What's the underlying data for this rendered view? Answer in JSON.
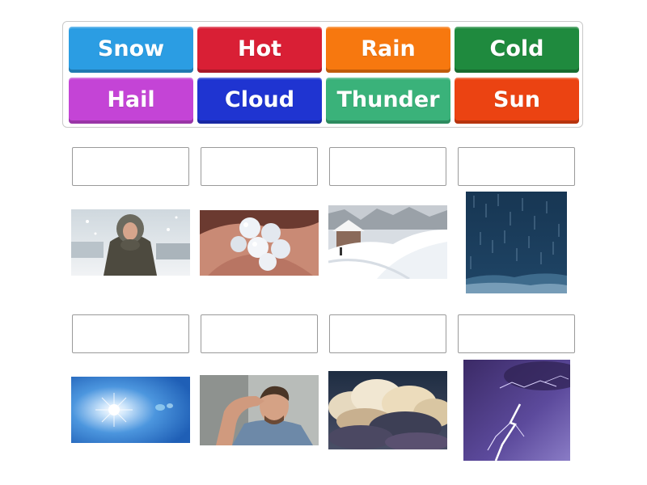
{
  "tiles": [
    {
      "label": "Snow",
      "color": "#2b9de3"
    },
    {
      "label": "Hot",
      "color": "#d91f35"
    },
    {
      "label": "Rain",
      "color": "#f7780f"
    },
    {
      "label": "Cold",
      "color": "#1f8a3e"
    },
    {
      "label": "Hail",
      "color": "#c444d6"
    },
    {
      "label": "Cloud",
      "color": "#1f34d1"
    },
    {
      "label": "Thunder",
      "color": "#3ab27a"
    },
    {
      "label": "Sun",
      "color": "#eb4312"
    }
  ],
  "images": [
    {
      "name": "cold-person-in-snow-image",
      "subject": "person in parka shivering in snow"
    },
    {
      "name": "hailstones-in-hand-image",
      "subject": "hailstones in hand"
    },
    {
      "name": "snowy-street-image",
      "subject": "snow covered street"
    },
    {
      "name": "rain-image",
      "subject": "rain falling"
    },
    {
      "name": "sun-image",
      "subject": "bright sun in blue sky"
    },
    {
      "name": "hot-man-sweating-image",
      "subject": "man wiping sweat from forehead"
    },
    {
      "name": "cloud-image",
      "subject": "storm clouds"
    },
    {
      "name": "lightning-image",
      "subject": "lightning bolt in purple sky"
    }
  ]
}
